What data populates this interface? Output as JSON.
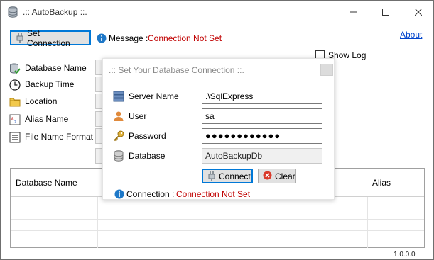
{
  "window": {
    "title": ".:: AutoBackup ::.",
    "minimize_glyph": "—",
    "maximize_glyph": "☐",
    "close_glyph": "✕"
  },
  "toolbar": {
    "set_connection_label": "Set Connection",
    "message_label": "Message :",
    "message_value": "Connection Not Set",
    "about_label": "About",
    "show_log_label": "Show Log",
    "show_log_checked": false
  },
  "form": {
    "fields": [
      {
        "label": "Database Name",
        "icon": "database-check-icon"
      },
      {
        "label": "Backup Time",
        "icon": "clock-icon"
      },
      {
        "label": "Location",
        "icon": "folder-icon"
      },
      {
        "label": "Alias Name",
        "icon": "alias-icon"
      },
      {
        "label": "File Name Format",
        "icon": "list-icon"
      }
    ]
  },
  "grid": {
    "columns": [
      "Database Name",
      "Alias"
    ]
  },
  "status": {
    "version": "1.0.0.0"
  },
  "dialog": {
    "title": ".:: Set Your Database Connection ::.",
    "server_name_label": "Server Name",
    "server_name_value": ".\\SqlExpress",
    "user_label": "User",
    "user_value": "sa",
    "password_label": "Password",
    "password_value": "●●●●●●●●●●●●",
    "database_label": "Database",
    "database_value": "AutoBackupDb",
    "connect_label": "Connect",
    "clear_label": "Clear",
    "connection_label": "Connection :",
    "connection_value": "Connection Not Set"
  },
  "colors": {
    "error_red": "#c00000",
    "link_blue": "#0044cc",
    "focus_blue": "#0078d7",
    "info_blue": "#1e78c8"
  }
}
